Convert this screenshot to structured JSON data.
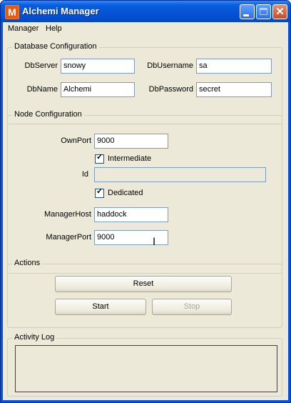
{
  "window": {
    "title": "Alchemi Manager",
    "icon": "alchemi-logo"
  },
  "menu": {
    "items": [
      "Manager",
      "Help"
    ]
  },
  "database": {
    "legend": "Database Configuration",
    "server_label": "DbServer",
    "server_value": "snowy",
    "username_label": "DbUsername",
    "username_value": "sa",
    "name_label": "DbName",
    "name_value": "Alchemi",
    "password_label": "DbPassword",
    "password_value": "secret"
  },
  "node": {
    "legend": "Node Configuration",
    "ownport_label": "OwnPort",
    "ownport_value": "9000",
    "intermediate_label": "Intermediate",
    "intermediate_checked": true,
    "id_label": "Id",
    "id_value": "",
    "dedicated_label": "Dedicated",
    "dedicated_checked": true,
    "managerhost_label": "ManagerHost",
    "managerhost_value": "haddock",
    "managerport_label": "ManagerPort",
    "managerport_value": "9000"
  },
  "actions": {
    "legend": "Actions",
    "reset_label": "Reset",
    "start_label": "Start",
    "stop_label": "Stop"
  },
  "activity_log": {
    "legend": "Activity Log",
    "content": ""
  },
  "colors": {
    "titlebar": "#0552d4",
    "client_bg": "#ece9d8",
    "close_button": "#c94a24"
  }
}
